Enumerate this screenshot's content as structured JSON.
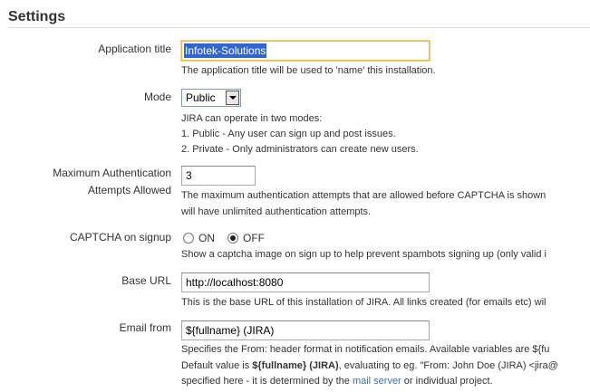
{
  "header": {
    "title": "Settings"
  },
  "fields": {
    "app_title": {
      "label": "Application title",
      "value": "Infotek-Solutions",
      "help": "The application title will be used to 'name' this installation."
    },
    "mode": {
      "label": "Mode",
      "selected": "Public",
      "help_lines": [
        "JIRA can operate in two modes:",
        "1. Public - Any user can sign up and post issues.",
        "2. Private - Only administrators can create new users."
      ]
    },
    "max_auth": {
      "label_line1": "Maximum Authentication",
      "label_line2": "Attempts Allowed",
      "value": "3",
      "help_lines": [
        "The maximum authentication attempts that are allowed before CAPTCHA is shown",
        "will have unlimited authentication attempts."
      ]
    },
    "captcha": {
      "label": "CAPTCHA on signup",
      "option_on": "ON",
      "option_off": "OFF",
      "selected": "OFF",
      "help": "Show a captcha image on sign up to help prevent spambots signing up (only valid i"
    },
    "base_url": {
      "label": "Base URL",
      "value": "http://localhost:8080",
      "help": "This is the base URL of this installation of JIRA. All links created (for emails etc) wil"
    },
    "email_from": {
      "label": "Email from",
      "value": "${fullname} (JIRA)",
      "help_line1": "Specifies the From: header format in notification emails. Available variables are ${fu",
      "help_line2_prefix": "Default value is ",
      "help_line2_bold": "${fullname} (JIRA)",
      "help_line2_suffix": ", evaluating to eg. \"From: John Doe (JIRA) <jira@",
      "help_line3_prefix": "specified here - it is determined by the ",
      "help_line3_link": "mail server",
      "help_line3_suffix": " or individual project."
    }
  },
  "colors": {
    "link": "#3b73af",
    "selection": "#3366cc",
    "focus_border": "#e5b94e"
  }
}
